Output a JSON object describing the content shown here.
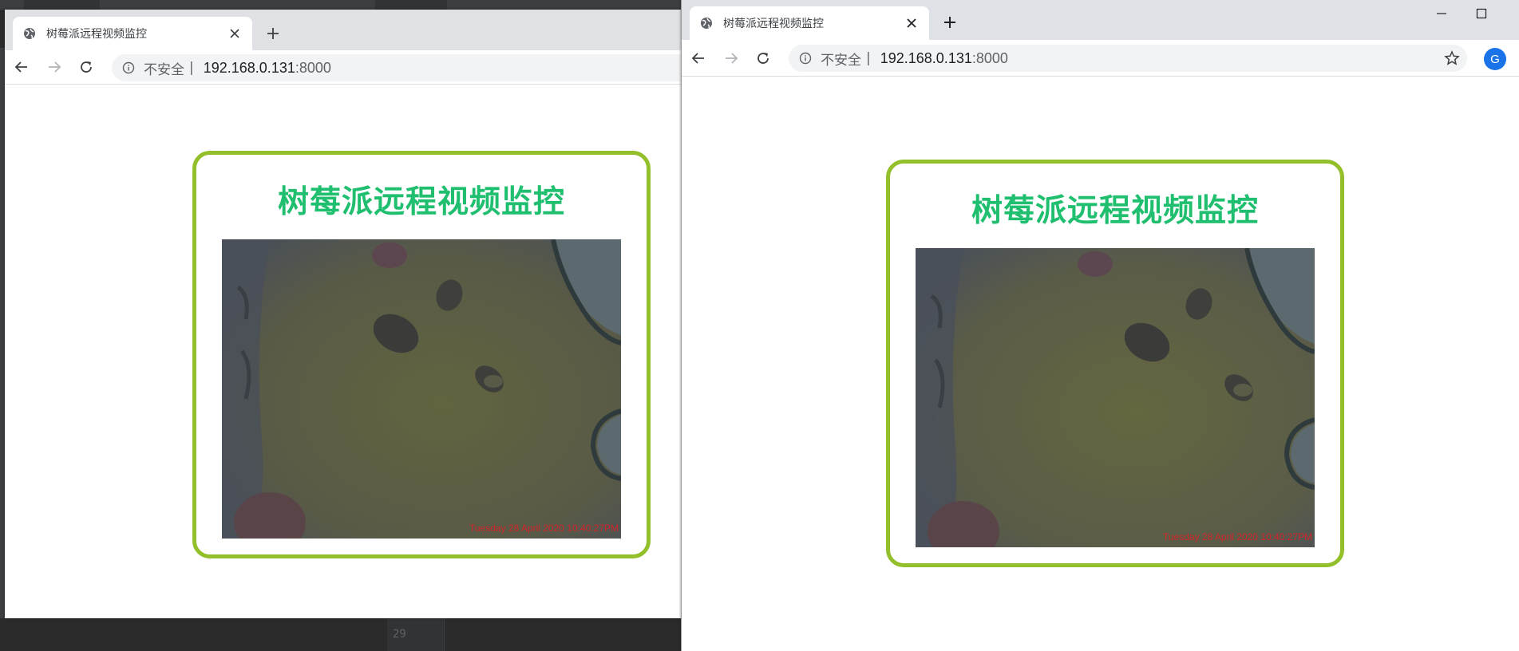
{
  "background_ide": {
    "line_number": "29"
  },
  "windows": [
    {
      "tab": {
        "title": "树莓派远程视频监控"
      },
      "address": {
        "security_label": "不安全",
        "separator": "|",
        "host": "192.168.0.131",
        "port": ":8000"
      },
      "page": {
        "heading": "树莓派远程视频监控",
        "video_timestamp": "Tuesday 28 April 2020 10:40:27PM"
      }
    },
    {
      "tab": {
        "title": "树莓派远程视频监控"
      },
      "address": {
        "security_label": "不安全",
        "separator": "|",
        "host": "192.168.0.131",
        "port": ":8000"
      },
      "profile_initial": "G",
      "page": {
        "heading": "树莓派远程视频监控",
        "video_timestamp": "Tuesday 28 April 2020 10:40:27PM"
      }
    }
  ],
  "icons": [
    "globe-icon",
    "close-icon",
    "plus-icon",
    "back-icon",
    "forward-icon",
    "reload-icon",
    "info-icon",
    "star-icon",
    "minimize-icon",
    "maximize-icon"
  ],
  "colors": {
    "card_border": "#93bf2a",
    "heading": "#1fbf6f",
    "timestamp": "#d1262a",
    "avatar": "#1a73e8"
  }
}
